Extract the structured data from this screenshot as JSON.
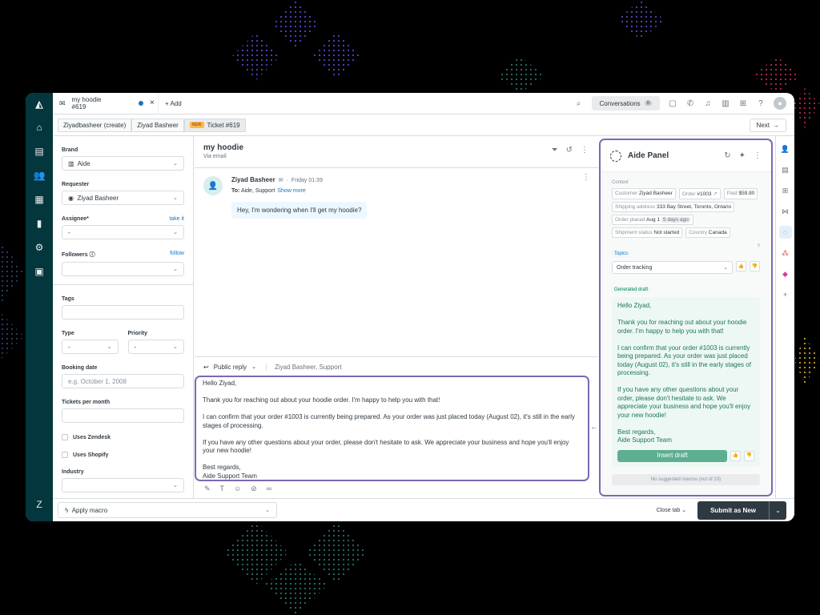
{
  "colors": {
    "accent": "#7b68b3",
    "nav_bg": "#03363d",
    "link": "#1f73b7",
    "draft_text": "#1c7653",
    "submit_bg": "#2f3941"
  },
  "tab": {
    "title": "my hoodie",
    "subtitle": "#619",
    "add_label": "+ Add"
  },
  "topbar": {
    "conversations_label": "Conversations",
    "conversations_count": "0"
  },
  "crumbs": {
    "items": [
      "Ziyadbasheer (create)",
      "Ziyad Basheer"
    ],
    "new_badge": "NEW",
    "ticket": "Ticket #619",
    "next": "Next"
  },
  "left": {
    "brand_label": "Brand",
    "brand_value": "Aide",
    "requester_label": "Requester",
    "requester_value": "Ziyad Basheer",
    "assignee_label": "Assignee*",
    "assignee_link": "take it",
    "assignee_value": "-",
    "followers_label": "Followers",
    "followers_link": "follow",
    "tags_label": "Tags",
    "type_label": "Type",
    "type_value": "-",
    "priority_label": "Priority",
    "priority_value": "-",
    "booking_label": "Booking date",
    "booking_placeholder": "e.g. October 1, 2008",
    "tickets_label": "Tickets per month",
    "zendesk_label": "Uses Zendesk",
    "shopify_label": "Uses Shopify",
    "industry_label": "Industry"
  },
  "ticket": {
    "title": "my hoodie",
    "via": "Via email"
  },
  "message": {
    "sender": "Ziyad Basheer",
    "time": "Friday 01:39",
    "to_label": "To:",
    "to_value": "Aide, Support",
    "show_more": "Show more",
    "body": "Hey, I'm wondering when I'll get my hoodie?"
  },
  "reply": {
    "mode": "Public reply",
    "recipients": "Ziyad Basheer, Support",
    "paragraphs": [
      "Hello Ziyad,",
      "Thank you for reaching out about your hoodie order. I'm happy to help you with that!",
      "I can confirm that your order #1003 is currently being prepared. As your order was just placed today (August 02), it's still in the early stages of processing.",
      "If you have any other questions about your order, please don't hesitate to ask. We appreciate your business and hope you'll enjoy your new hoodie!",
      "Best regards,",
      "Aide Support Team"
    ]
  },
  "aide": {
    "title": "Aide Panel",
    "context_label": "Context",
    "customer_k": "Customer",
    "customer_v": "Ziyad Basheer",
    "order_k": "Order",
    "order_v": "#1003",
    "paid_k": "Paid",
    "paid_v": "$59.80",
    "ship_k": "Shipping address",
    "ship_v": "333 Bay Street, Toronto, Ontario",
    "placed_k": "Order placed",
    "placed_v": "Aug 1",
    "placed_ago": "5 days ago",
    "status_k": "Shipment status",
    "status_v": "Not started",
    "country_k": "Country",
    "country_v": "Canada",
    "topics_label": "Topics",
    "topic_value": "Order tracking",
    "draft_label": "Generated draft",
    "draft_paragraphs": [
      "Hello Ziyad,",
      "Thank you for reaching out about your hoodie order. I'm happy to help you with that!",
      "I can confirm that your order #1003 is currently being prepared. As your order was just placed today (August 02), it's still in the early stages of processing.",
      "If you have any other questions about your order, please don't hesitate to ask. We appreciate your business and hope you'll enjoy your new hoodie!"
    ],
    "draft_sign1": "Best regards,",
    "draft_sign2": "Aide Support Team",
    "insert_label": "Insert draft",
    "macros_label": "No suggested macros (out of 23)"
  },
  "bottom": {
    "macro_label": "Apply macro",
    "close_tab": "Close tab",
    "submit": "Submit as New"
  }
}
